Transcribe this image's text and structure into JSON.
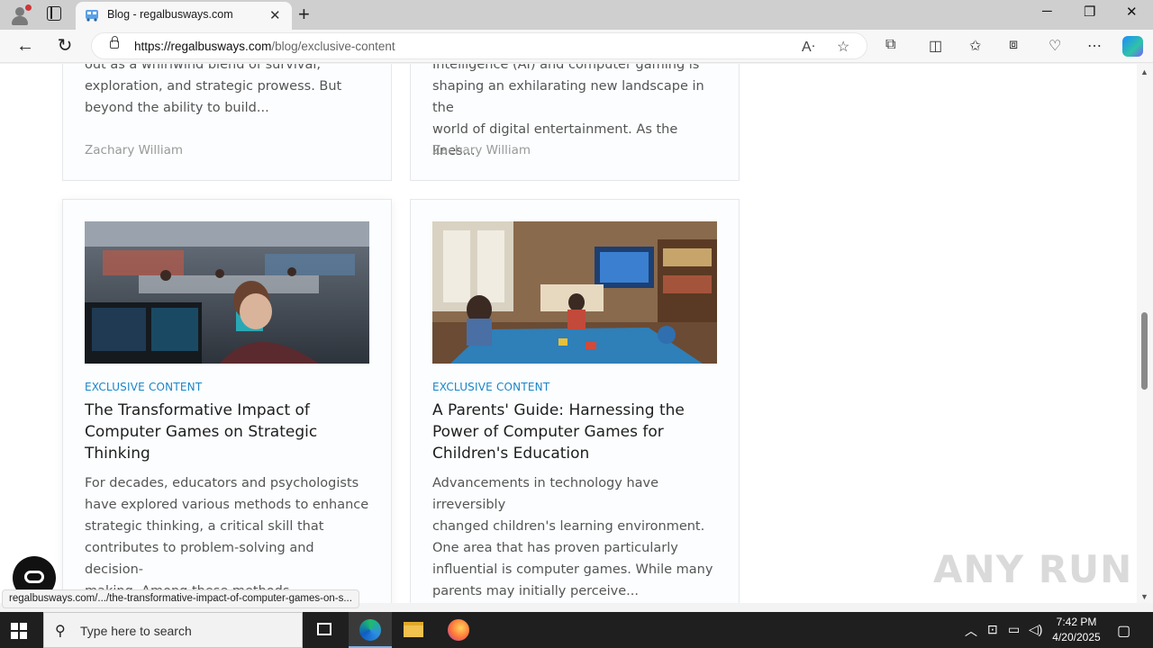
{
  "browser": {
    "tab_title": "Blog - regalbusways.com",
    "url_host": "https://regalbusways.com",
    "url_path": "/blog/exclusive-content",
    "status_link": "regalbusways.com/.../the-transformative-impact-of-computer-games-on-s..."
  },
  "top_cards": [
    {
      "excerpt_lines": [
        "out as a whirlwind blend of survival,",
        "exploration, and strategic prowess. But",
        "beyond the ability to build..."
      ],
      "author": "Zachary William"
    },
    {
      "excerpt_lines": [
        "Intelligence (AI) and computer gaming is",
        "shaping an exhilarating new landscape in the",
        "world of digital entertainment. As the lines..."
      ],
      "author": "Zachary William"
    }
  ],
  "cards": [
    {
      "category": "EXCLUSIVE CONTENT",
      "title_lines": [
        "The Transformative Impact of",
        "Computer Games on Strategic",
        "Thinking"
      ],
      "excerpt_lines": [
        "For decades, educators and psychologists",
        "have explored various methods to enhance",
        "strategic thinking, a critical skill that",
        "contributes to problem-solving and decision-",
        "making. Among these methods..."
      ]
    },
    {
      "category": "EXCLUSIVE CONTENT",
      "title_lines": [
        "A Parents' Guide: Harnessing the",
        "Power of Computer Games for",
        "Children's Education"
      ],
      "excerpt_lines": [
        "Advancements in technology have irreversibly",
        "changed children's learning environment.",
        "One area that has proven particularly",
        "influential is computer games. While many",
        "parents may initially perceive..."
      ]
    }
  ],
  "watermark": "ANY RUN",
  "taskbar": {
    "search_placeholder": "Type here to search",
    "time": "7:42 PM",
    "date": "4/20/2025"
  },
  "colors": {
    "category": "#1a86c9",
    "taskbar": "#1f1f1f"
  }
}
